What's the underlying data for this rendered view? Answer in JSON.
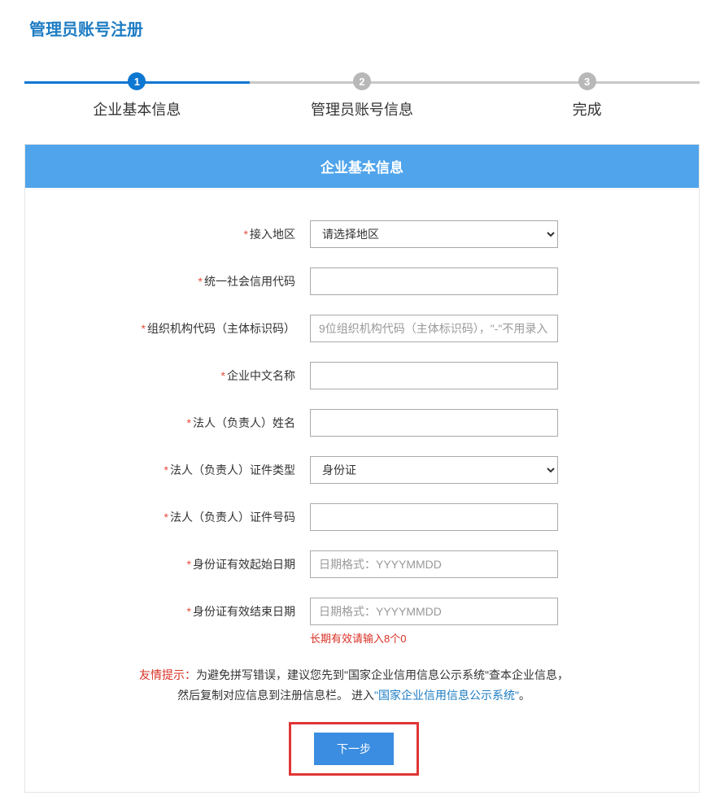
{
  "title": "管理员账号注册",
  "steps": [
    "企业基本信息",
    "管理员账号信息",
    "完成"
  ],
  "stepNums": [
    "1",
    "2",
    "3"
  ],
  "cardHeader": "企业基本信息",
  "fields": {
    "region": {
      "label": "接入地区",
      "placeholder": "请选择地区"
    },
    "uscc": {
      "label": "统一社会信用代码"
    },
    "orgcode": {
      "label": "组织机构代码（主体标识码）",
      "placeholder": "9位组织机构代码（主体标识码），\"-\"不用录入"
    },
    "cnname": {
      "label": "企业中文名称"
    },
    "legalname": {
      "label": "法人（负责人）姓名"
    },
    "idtype": {
      "label": "法人（负责人）证件类型",
      "value": "身份证"
    },
    "idnum": {
      "label": "法人（负责人）证件号码"
    },
    "startdate": {
      "label": "身份证有效起始日期",
      "placeholder": "日期格式：YYYYMMDD"
    },
    "enddate": {
      "label": "身份证有效结束日期",
      "placeholder": "日期格式：YYYYMMDD",
      "hint": "长期有效请输入8个0"
    }
  },
  "tip": {
    "prefix": "友情提示：",
    "line1a": "为避免拼写错误，建议您先到",
    "line1quote": "\"国家企业信用信息公示系统\"",
    "line1b": "查本企业信息，",
    "line2a": "然后复制对应信息到注册信息栏。 进入",
    "line2link": "\"国家企业信用信息公示系统\"",
    "period": "。"
  },
  "nextButton": "下一步"
}
